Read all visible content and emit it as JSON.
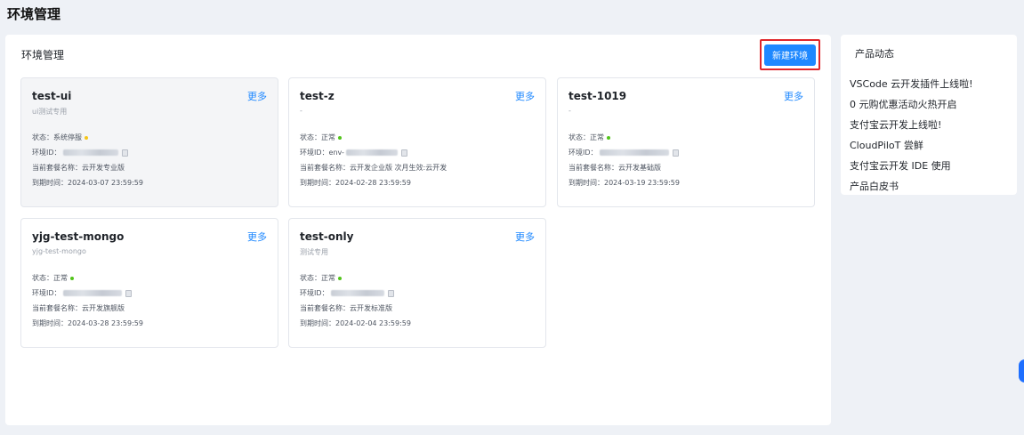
{
  "page": {
    "title": "环境管理"
  },
  "main": {
    "title": "环境管理",
    "create_button": "新建环境",
    "labels": {
      "status": "状态：",
      "env_id": "环境ID：",
      "package": "当前套餐名称：",
      "expire": "到期时间："
    },
    "more_label": "更多",
    "cards": [
      {
        "name": "test-ui",
        "desc": "ui测试专用",
        "status": "系统停服",
        "status_color": "#f5c518",
        "env_id_prefix": "",
        "package": "云开发专业版",
        "expire": "2024-03-07 23:59:59"
      },
      {
        "name": "test-z",
        "desc": "-",
        "status": "正常",
        "status_color": "#52c41a",
        "env_id_prefix": "env-",
        "package": "云开发企业版 次月生效:云开发",
        "expire": "2024-02-28 23:59:59"
      },
      {
        "name": "test-1019",
        "desc": "-",
        "status": "正常",
        "status_color": "#52c41a",
        "env_id_prefix": "",
        "package": "云开发基础版",
        "expire": "2024-03-19 23:59:59"
      },
      {
        "name": "yjg-test-mongo",
        "desc": "yjg-test-mongo",
        "status": "正常",
        "status_color": "#52c41a",
        "env_id_prefix": "",
        "package": "云开发旗舰版",
        "expire": "2024-03-28 23:59:59"
      },
      {
        "name": "test-only",
        "desc": "测试专用",
        "status": "正常",
        "status_color": "#52c41a",
        "env_id_prefix": "",
        "package": "云开发标准版",
        "expire": "2024-02-04 23:59:59"
      }
    ]
  },
  "side": {
    "title": "产品动态",
    "items": [
      "VSCode 云开发插件上线啦!",
      "0 元购优惠活动火热开启",
      "支付宝云开发上线啦!",
      "CloudPiloT 尝鲜",
      "支付宝云开发 IDE 使用",
      "产品白皮书"
    ]
  }
}
